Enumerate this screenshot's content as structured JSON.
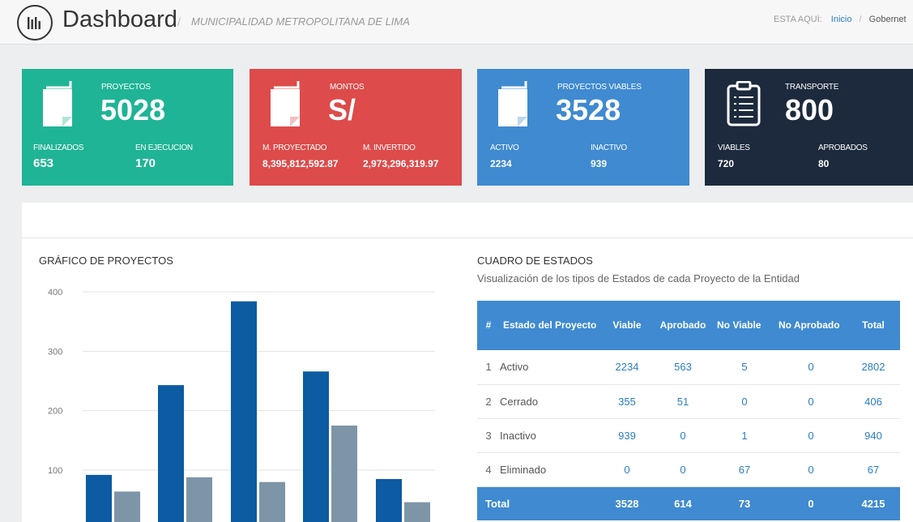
{
  "header": {
    "title": "Dashboard",
    "subtitle": "MUNICIPALIDAD METROPOLITANA DE LIMA",
    "breadcrumb": {
      "prefix": "ESTA AQUÍ:",
      "home": "Inicio",
      "current": "Gobernet"
    }
  },
  "cards": [
    {
      "label": "PROYECTOS",
      "value": "5028",
      "color": "#1fb495",
      "icon": "document-icon",
      "subs": [
        {
          "label": "FINALIZADOS",
          "value": "653"
        },
        {
          "label": "EN EJECUCION",
          "value": "170"
        }
      ]
    },
    {
      "label": "MONTOS",
      "value": "S/",
      "color": "#dd4b4b",
      "icon": "document-icon",
      "subs": [
        {
          "label": "M. PROYECTADO",
          "value": "8,395,812,592.87"
        },
        {
          "label": "M. INVERTIDO",
          "value": "2,973,296,319.97"
        }
      ]
    },
    {
      "label": "PROYECTOS VIABLES",
      "value": "3528",
      "color": "#3f8ad0",
      "icon": "document-icon",
      "subs": [
        {
          "label": "ACTIVO",
          "value": "2234"
        },
        {
          "label": "INACTIVO",
          "value": "939"
        }
      ]
    },
    {
      "label": "TRANSPORTE",
      "value": "800",
      "color": "#1d2a3d",
      "icon": "clipboard-icon",
      "subs": [
        {
          "label": "VIABLES",
          "value": "720"
        },
        {
          "label": "APROBADOS",
          "value": "80"
        }
      ]
    }
  ],
  "chart_section": {
    "title": "GRÁFICO DE PROYECTOS"
  },
  "chart_data": {
    "type": "bar",
    "title": "GRÁFICO DE PROYECTOS",
    "categories": [
      "",
      "",
      "",
      "",
      ""
    ],
    "series": [
      {
        "values": [
          92,
          243,
          384,
          266,
          85
        ],
        "color": "#0c5ba3"
      },
      {
        "values": [
          64,
          88,
          80,
          175,
          46
        ],
        "color": "#7e95a8"
      }
    ],
    "yticks": [
      100,
      200,
      300,
      400
    ],
    "ylim": [
      0,
      410
    ],
    "grid": true
  },
  "table_section": {
    "title": "CUADRO DE ESTADOS",
    "description": "Visualización de los tipos de Estados de cada Proyecto de la Entidad",
    "headers": [
      "#",
      "Estado del Proyecto",
      "Viable",
      "Aprobado",
      "No Viable",
      "No Aprobado",
      "Total"
    ],
    "rows": [
      [
        "1",
        "Activo",
        "2234",
        "563",
        "5",
        "0",
        "2802"
      ],
      [
        "2",
        "Cerrado",
        "355",
        "51",
        "0",
        "0",
        "406"
      ],
      [
        "3",
        "Inactivo",
        "939",
        "0",
        "1",
        "0",
        "940"
      ],
      [
        "4",
        "Eliminado",
        "0",
        "0",
        "67",
        "0",
        "67"
      ]
    ],
    "total": [
      "Total",
      "3528",
      "614",
      "73",
      "0",
      "4215"
    ]
  }
}
